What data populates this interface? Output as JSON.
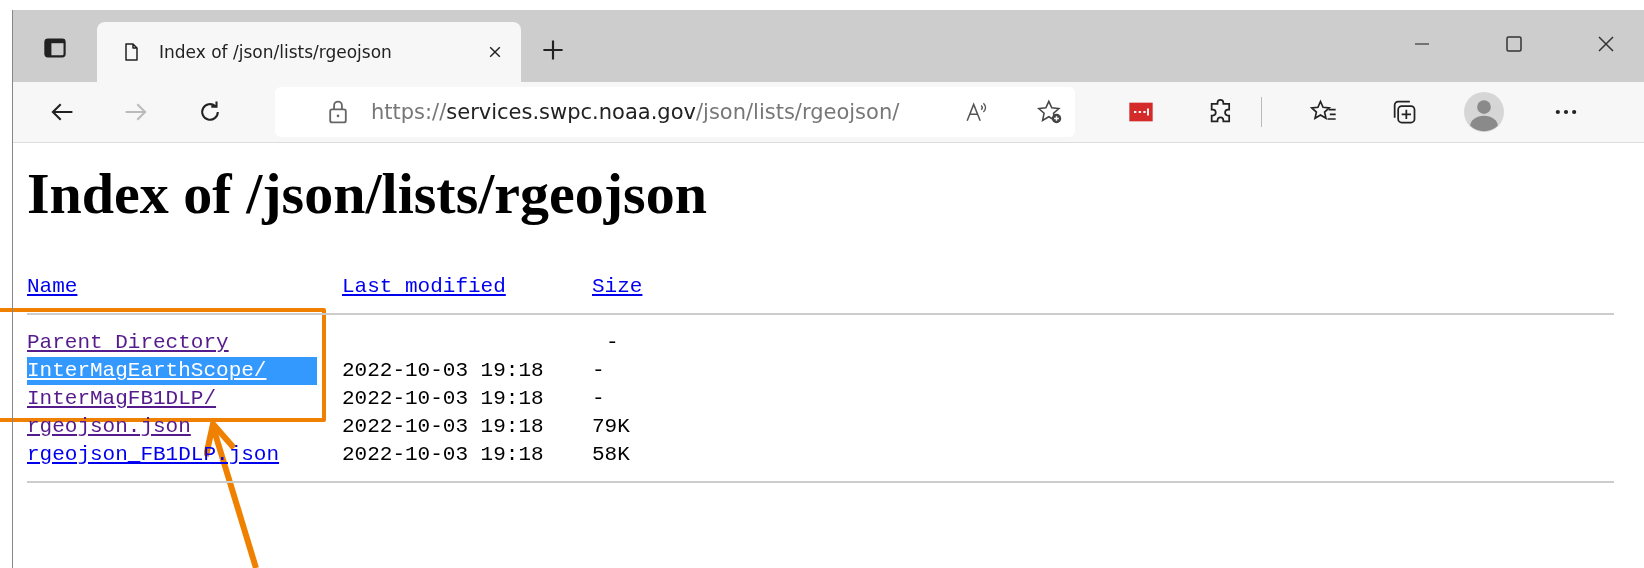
{
  "browser": {
    "tabs": [
      {
        "title": "Index of /json/lists/rgeojson",
        "selected": true
      }
    ],
    "address": {
      "scheme": "https://",
      "host": "services.swpc.noaa.gov",
      "path": "/json/lists/rgeojson/"
    }
  },
  "page": {
    "heading": "Index of /json/lists/rgeojson",
    "columns": [
      {
        "label": "Name"
      },
      {
        "label": "Last modified"
      },
      {
        "label": "Size"
      }
    ],
    "rows": [
      {
        "name": "Parent Directory",
        "modified": "",
        "size": "-",
        "visited": true,
        "selected": false
      },
      {
        "name": "InterMagEarthScope/",
        "modified": "2022-10-03 19:18",
        "size": "-",
        "visited": true,
        "selected": true
      },
      {
        "name": "InterMagFB1DLP/",
        "modified": "2022-10-03 19:18",
        "size": "-",
        "visited": true,
        "selected": false
      },
      {
        "name": "rgeojson.json",
        "modified": "2022-10-03 19:18",
        "size": "79K",
        "visited": true,
        "selected": false
      },
      {
        "name": "rgeojson_FB1DLP.json",
        "modified": "2022-10-03 19:18",
        "size": "58K",
        "visited": false,
        "selected": false
      }
    ]
  }
}
